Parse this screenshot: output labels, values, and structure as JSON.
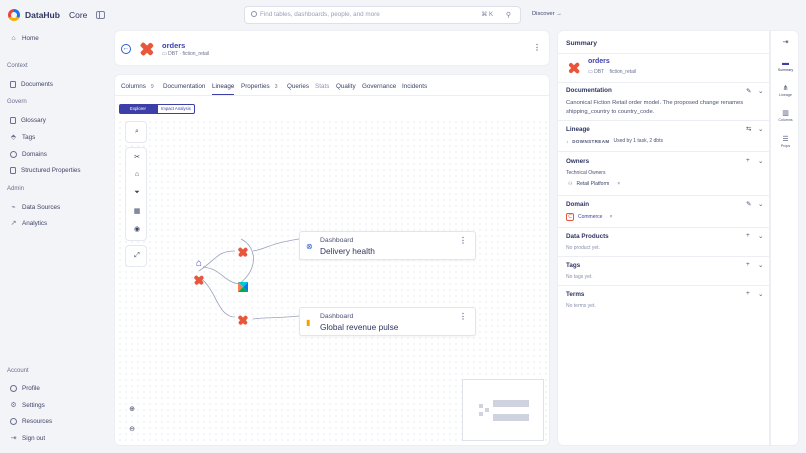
{
  "app": {
    "brand": "DataHub",
    "edition": "Core"
  },
  "search": {
    "placeholder": "Find tables, dashboards, people, and more",
    "shortcut": "⌘ K"
  },
  "header": {
    "discover_label": "Discover →"
  },
  "nav": {
    "home": "Home",
    "sections": {
      "context": "Context",
      "govern": "Govern",
      "admin": "Admin",
      "account": "Account"
    },
    "context_items": [
      "Documents"
    ],
    "govern_items": [
      "Glossary",
      "Tags",
      "Domains",
      "Structured Properties"
    ],
    "admin_items": [
      "Data Sources",
      "Analytics"
    ],
    "account_items": [
      "Profile",
      "Settings",
      "Resources",
      "Sign out"
    ]
  },
  "entity": {
    "name": "orders",
    "platform": "DBT",
    "container": "fiction_retail"
  },
  "tabs": [
    {
      "label": "Columns",
      "count": "9"
    },
    {
      "label": "Documentation",
      "count": ""
    },
    {
      "label": "Lineage",
      "count": ""
    },
    {
      "label": "Properties",
      "count": "3"
    },
    {
      "label": "Queries",
      "count": ""
    },
    {
      "label": "Stats",
      "count": ""
    },
    {
      "label": "Quality",
      "count": ""
    },
    {
      "label": "Governance",
      "count": ""
    },
    {
      "label": "Incidents",
      "count": ""
    }
  ],
  "lineage": {
    "mode_explorer": "Explorer",
    "mode_impact": "Impact Analysis",
    "nodes": [
      {
        "type": "Dashboard",
        "title": "Delivery health"
      },
      {
        "type": "Dashboard",
        "title": "Global revenue pulse"
      }
    ]
  },
  "summary": {
    "title": "Summary",
    "entity_name": "orders",
    "platform": "DBT",
    "container": "fiction_retail",
    "documentation_heading": "Documentation",
    "documentation_text": "Canonical Fiction Retail order model. The proposed change renames shipping_country to country_code.",
    "lineage_heading": "Lineage",
    "downstream_label": "DOWNSTREAM",
    "downstream_text": "Used by 1 task, 2 dbts",
    "owners_heading": "Owners",
    "owners_sub": "Technical Owners",
    "owner_name": "Retail Platform",
    "domain_heading": "Domain",
    "domain_letter": "C",
    "domain_name": "Commerce",
    "data_products_heading": "Data Products",
    "data_products_empty": "No product yet.",
    "tags_heading": "Tags",
    "tags_empty": "No tags yet.",
    "terms_heading": "Terms",
    "terms_empty": "No terms yet."
  },
  "side_tabs": [
    "Summary",
    "Lineage",
    "Columns",
    "Props"
  ],
  "colors": {
    "accent": "#3c3fa8",
    "dbt": "#e8563c",
    "link": "#2f5ed3"
  }
}
